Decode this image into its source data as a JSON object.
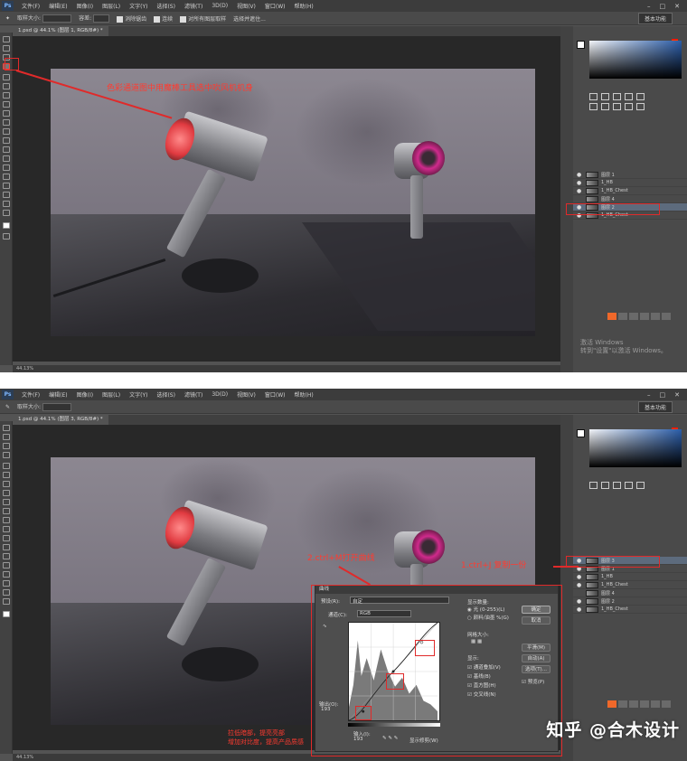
{
  "app": {
    "logo": "Ps"
  },
  "menubar": {
    "items": [
      "文件(F)",
      "编辑(E)",
      "图像(I)",
      "图层(L)",
      "文字(Y)",
      "选择(S)",
      "滤镜(T)",
      "3D(D)",
      "视图(V)",
      "窗口(W)",
      "帮助(H)"
    ],
    "controls": [
      "–",
      "□",
      "✕"
    ]
  },
  "toolbar": {
    "tolerance": "容差:",
    "sample": "取样大小:",
    "sample_value": "取样点",
    "aa": "消除锯齿",
    "contiguous": "连续",
    "all_layers": "对所有图层取样",
    "refine": "选择并遮住...",
    "workspace": "基本功能"
  },
  "shot1": {
    "tab": "1.psd @ 44.1% (图层 1, RGB/8#) *",
    "annotation": "色彩通道图中用魔棒工具选中吹风机机身",
    "status": "44.13%",
    "watermark_line1": "激活 Windows",
    "watermark_line2": "转到\"设置\"以激活 Windows。",
    "layers": [
      "图层 1",
      "1_HB",
      "1_HB_Chest",
      "图层 4",
      "图层 2",
      "1_HB_Chest"
    ]
  },
  "shot2": {
    "tab": "1.psd @ 44.1% (图层 3, RGB/8#) *",
    "annotation_curves": "2.ctrl+M打开曲线",
    "annotation_copy": "1.ctrl+J 复制一份",
    "note_line1": "拉低暗部，提亮亮部",
    "note_line2": "增加对比度，提高产品质感",
    "status": "44.13%",
    "layers": [
      "图层 3",
      "图层 1",
      "1_HB",
      "1_HB_Chest",
      "图层 4",
      "图层 2",
      "1_HB_Chest"
    ]
  },
  "curves": {
    "title": "曲线",
    "preset_label": "预设(R):",
    "preset_value": "自定",
    "channel_label": "通道(C):",
    "channel_value": "RGB",
    "show_amount": "显示数量:",
    "light": "光 (0-255)(L)",
    "pigment": "颜料/油墨 %(G)",
    "grid_size": "网格大小:",
    "show": "显示:",
    "opt_channel": "通道叠加(V)",
    "opt_baseline": "基线(B)",
    "opt_hist": "直方图(H)",
    "opt_intersect": "交叉线(N)",
    "ok": "确定",
    "cancel": "取消",
    "smooth": "平滑(M)",
    "auto": "自动(A)",
    "options": "选项(T)...",
    "preview": "预览(P)",
    "output_label": "输出(O):",
    "output_value": "193",
    "input_label": "输入(I):",
    "input_value": "193",
    "show_clip": "显示修剪(W)"
  },
  "credit": "知乎 @合木设计",
  "colors": {
    "annotation": "#ff3b30",
    "ps_bg": "#535353",
    "menu_bg": "#3c3c3c"
  }
}
